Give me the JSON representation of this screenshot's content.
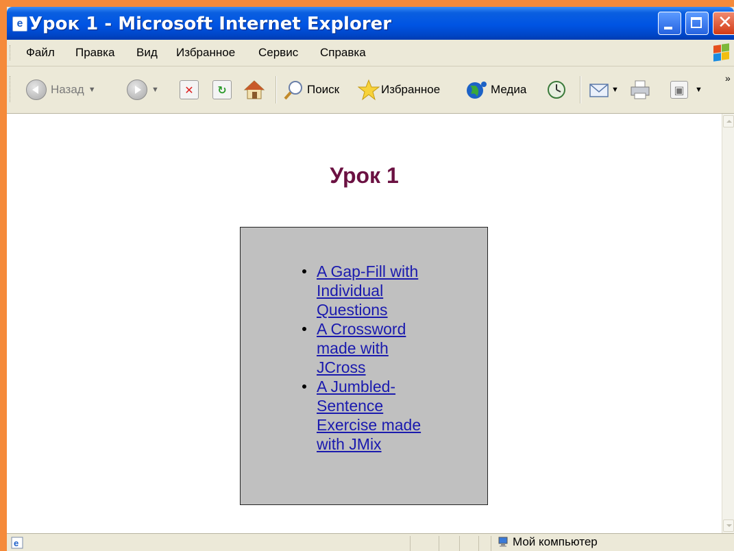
{
  "window": {
    "title": "Урок 1 - Microsoft Internet Explorer"
  },
  "menu": {
    "items": [
      {
        "label": "Файл"
      },
      {
        "label": "Правка"
      },
      {
        "label": "Вид"
      },
      {
        "label": "Избранное"
      },
      {
        "label": "Сервис"
      },
      {
        "label": "Справка"
      }
    ]
  },
  "toolbar": {
    "back_label": "Назад",
    "search_label": "Поиск",
    "favorites_label": "Избранное",
    "media_label": "Медиа",
    "overflow_label": "»"
  },
  "page": {
    "heading": "Урок 1",
    "links": [
      {
        "text": "A Gap-Fill with Individual Questions"
      },
      {
        "text": "A Crossword made with JCross"
      },
      {
        "text": "A Jumbled-Sentence Exercise made with JMix"
      }
    ]
  },
  "status": {
    "zone": "Мой компьютер"
  },
  "colors": {
    "titlebar": "#0054E3",
    "heading": "#6B1142",
    "link": "#1A1AAE",
    "box_bg": "#C0C0C0",
    "desktop": "#F58A3A"
  }
}
